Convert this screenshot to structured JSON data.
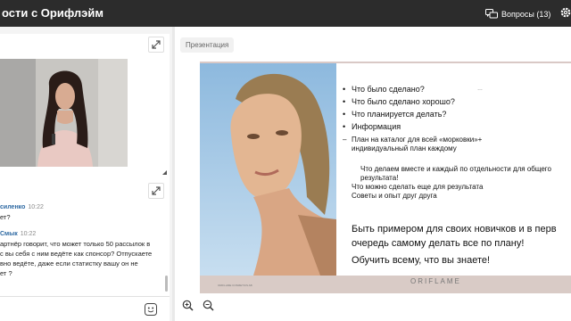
{
  "header": {
    "title": "ости с Орифлэйм",
    "questions_label": "Вопросы (13)"
  },
  "presentation": {
    "tab_label": "Презентация",
    "slide": {
      "bullets": [
        "Что было сделано?",
        "Что было сделано хорошо?",
        "Что планируется делать?",
        "Информация"
      ],
      "sub_line1": "План на каталог для всей «морковки»+",
      "sub_line2": "индивидуальный план каждому",
      "plain1": "Что делаем вместе и каждый по отдельности для общего",
      "plain2": "результата!",
      "plain3": "Что можно сделать еще для результата",
      "plain4": "Советы и опыт друг друга",
      "big1": "Быть примером для своих новичков и в перв",
      "big2": "очередь самому делать все по плану!",
      "big3": "Обучить всему, что вы знаете!",
      "brand": "ORIFLAME",
      "footer_fine": "ORIFLAME COSMETICS AB",
      "dot": "…"
    }
  },
  "chat": {
    "messages": [
      {
        "author": "силенко",
        "time": "10:22",
        "lines": [
          "ет?"
        ]
      },
      {
        "author": "Смык",
        "time": "10:22",
        "lines": [
          "артнёр говорит, что может только 50 рассылок в",
          "с вы себя с ним ведёте как спонсор? Отпускаете",
          "вно ведёте, даже если статистку вашу он не",
          "ет ?"
        ]
      }
    ]
  },
  "colors": {
    "topbar": "#2c2c2c",
    "author": "#2f6aa3",
    "slide_band": "#d9cbc6"
  }
}
